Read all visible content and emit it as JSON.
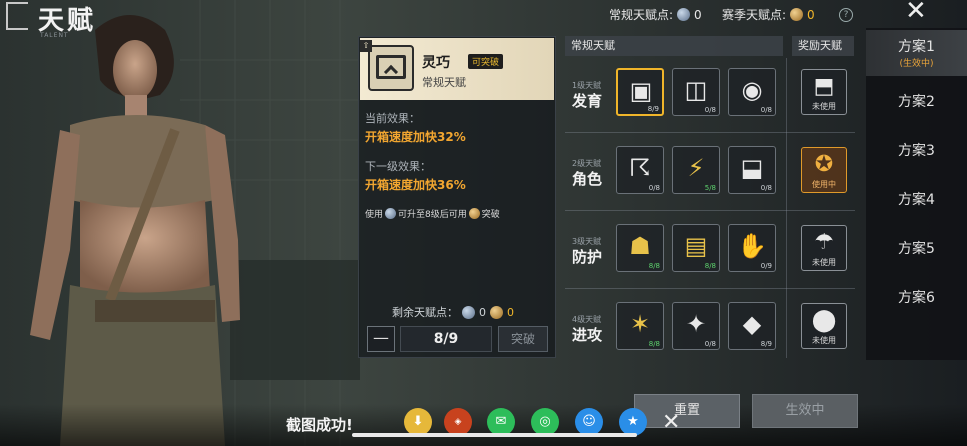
{
  "header": {
    "title": "天赋",
    "subtitle": "TALENT"
  },
  "top_stats": {
    "regular_label": "常规天赋点:",
    "regular_value": "0",
    "season_label": "赛季天赋点:",
    "season_value": "0",
    "help": "?",
    "close": "✕"
  },
  "detail": {
    "name": "灵巧",
    "badge": "可突破",
    "type": "常规天赋",
    "current_label": "当前效果：",
    "current_effect": "开箱速度加快32%",
    "next_label": "下一级效果：",
    "next_effect": "开箱速度加快36%",
    "note_pre": "使用",
    "note_mid": "可升至8级后可用",
    "note_post": "突破",
    "remain_label": "剩余天赋点：",
    "remain_blue": "0",
    "remain_gold": "0",
    "minus": "—",
    "count": "8/9",
    "break_button": "突破"
  },
  "grid": {
    "regular_header": "常规天赋",
    "bonus_header": "奖励天赋",
    "rows": [
      {
        "small": "1级天赋",
        "big": "发育",
        "cells": [
          {
            "icon": "supply-crate-icon",
            "glyph": "▣",
            "level": "8/9",
            "selected": true,
            "green": false
          },
          {
            "icon": "loot-box-icon",
            "glyph": "◫",
            "level": "0/8",
            "selected": false,
            "green": false
          },
          {
            "icon": "throw-icon",
            "glyph": "◉",
            "level": "0/8",
            "selected": false,
            "green": false
          }
        ],
        "bonus": {
          "icon": "bonus-crate-icon",
          "glyph": "⬒",
          "status": "未使用",
          "active": false
        }
      },
      {
        "small": "2级天赋",
        "big": "角色",
        "cells": [
          {
            "icon": "sprint-sound-icon",
            "glyph": "☈",
            "level": "0/8",
            "selected": false,
            "green": false
          },
          {
            "icon": "runner-icon",
            "glyph": "⚡",
            "level": "5/8",
            "selected": false,
            "green": true
          },
          {
            "icon": "backpack-icon",
            "glyph": "⬓",
            "level": "0/8",
            "selected": false,
            "green": false
          }
        ],
        "bonus": {
          "icon": "muscle-icon",
          "glyph": "✪",
          "status": "使用中",
          "active": true
        }
      },
      {
        "small": "3级天赋",
        "big": "防护",
        "cells": [
          {
            "icon": "strength-icon",
            "glyph": "☗",
            "level": "8/8",
            "selected": false,
            "green": true
          },
          {
            "icon": "vest-icon",
            "glyph": "▤",
            "level": "8/8",
            "selected": false,
            "green": true
          },
          {
            "icon": "glove-icon",
            "glyph": "✋",
            "level": "0/9",
            "selected": false,
            "green": false
          }
        ],
        "bonus": {
          "icon": "parachute-icon",
          "glyph": "☂",
          "status": "未使用",
          "active": false
        }
      },
      {
        "small": "4级天赋",
        "big": "进攻",
        "cells": [
          {
            "icon": "rifle-icon",
            "glyph": "✶",
            "level": "8/8",
            "selected": false,
            "green": true
          },
          {
            "icon": "melee-icon",
            "glyph": "✦",
            "level": "0/8",
            "selected": false,
            "green": false
          },
          {
            "icon": "ammo-crate-icon",
            "glyph": "◆",
            "level": "8/9",
            "selected": false,
            "green": false
          }
        ],
        "bonus": {
          "icon": "grenade-icon",
          "glyph": "⬤",
          "status": "未使用",
          "active": false
        }
      }
    ]
  },
  "tabs": [
    {
      "label": "方案1",
      "sub": "(生效中)"
    },
    {
      "label": "方案2",
      "sub": ""
    },
    {
      "label": "方案3",
      "sub": ""
    },
    {
      "label": "方案4",
      "sub": ""
    },
    {
      "label": "方案5",
      "sub": ""
    },
    {
      "label": "方案6",
      "sub": ""
    }
  ],
  "bottom": {
    "screenshot_text": "截图成功!",
    "reset_button": "重置",
    "effective_button": "生效中",
    "close": "✕"
  },
  "colors": {
    "accent": "#f0b52a",
    "effect": "#f2a630",
    "active_sub": "#e9a43a"
  }
}
